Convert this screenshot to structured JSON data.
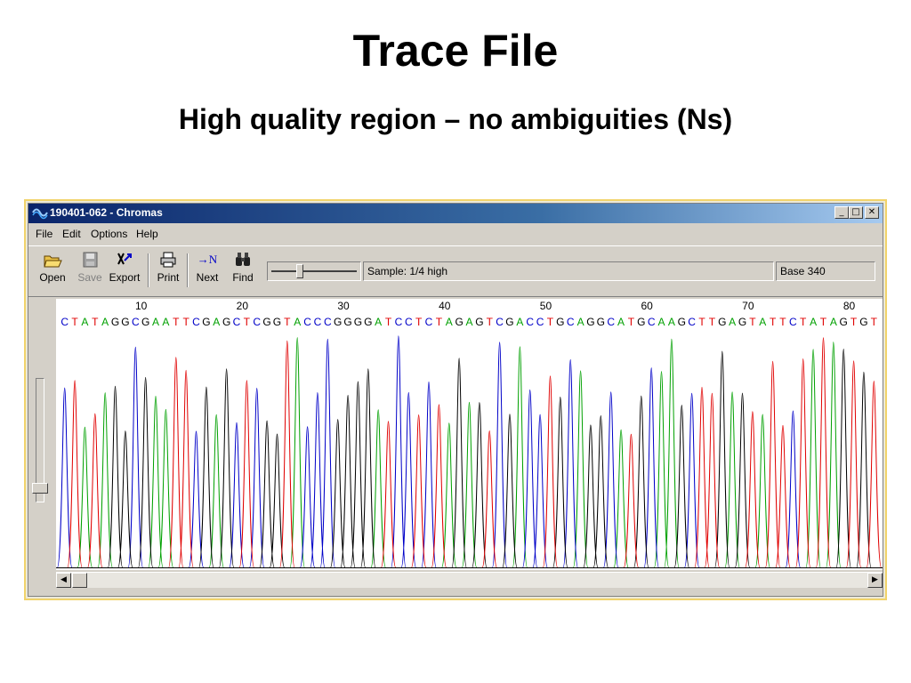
{
  "slide": {
    "title": "Trace File",
    "subtitle": "High quality region – no ambiguities (Ns)"
  },
  "window": {
    "title": "190401-062 - Chromas",
    "buttons": {
      "minimize": "_",
      "maximize": "□",
      "close": "✕"
    }
  },
  "menu": [
    "File",
    "Edit",
    "Options",
    "Help"
  ],
  "toolbar": {
    "buttons": [
      {
        "label": "Open",
        "icon": "open-folder-icon"
      },
      {
        "label": "Save",
        "icon": "save-disk-icon",
        "disabled": true
      },
      {
        "label": "Export",
        "icon": "export-icon"
      },
      {
        "label": "Print",
        "icon": "printer-icon"
      },
      {
        "label": "Next",
        "icon": "next-n-icon",
        "glyph": "→N"
      },
      {
        "label": "Find",
        "icon": "binoculars-icon"
      }
    ],
    "zoom_level": 0.33,
    "sample": "Sample: 1/4 high",
    "base": "Base 340"
  },
  "trace": {
    "ruler": [
      "10",
      "20",
      "30",
      "40",
      "50",
      "60",
      "70",
      "80"
    ],
    "sequence": "CTATAGGCGAATTCGAGCTCGGTACCCGGGGATCCTCTAGAGTCGACCTGCAGGCATGCAAGCTTGAGTATTCTATAGTGT",
    "colors": {
      "A": "#00a000",
      "C": "#0000c8",
      "G": "#000000",
      "T": "#e00000"
    }
  }
}
